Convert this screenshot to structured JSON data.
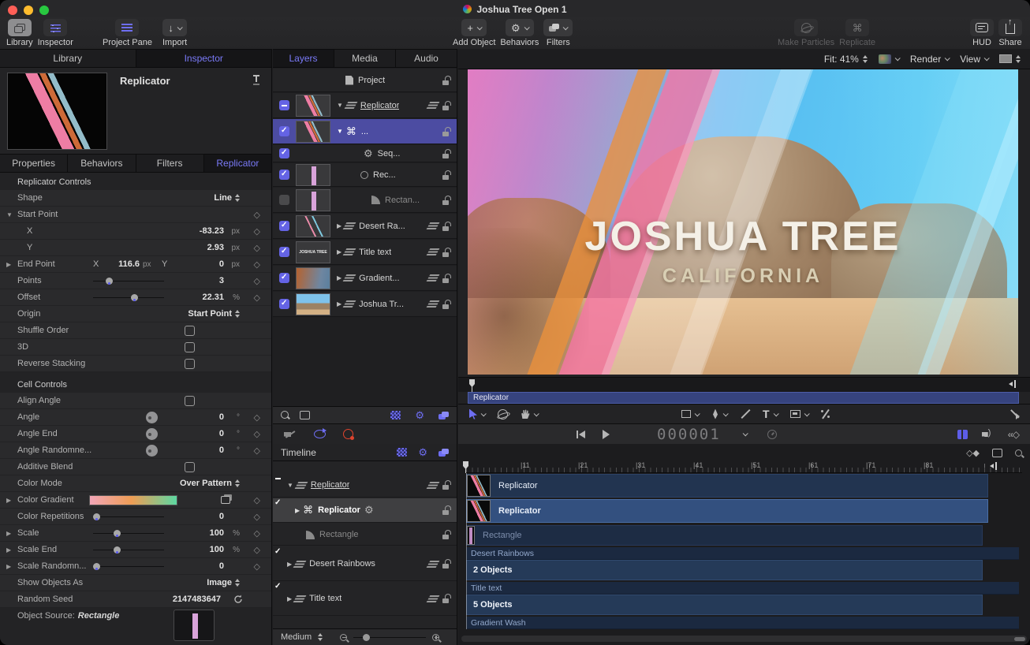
{
  "window": {
    "title": "Joshua Tree Open 1"
  },
  "toolbar": {
    "library": "Library",
    "inspector": "Inspector",
    "project_pane": "Project Pane",
    "import": "Import",
    "add_object": "Add Object",
    "behaviors": "Behaviors",
    "filters": "Filters",
    "make_particles": "Make Particles",
    "replicate": "Replicate",
    "hud": "HUD",
    "share": "Share"
  },
  "left_panel": {
    "tabs": {
      "library": "Library",
      "inspector": "Inspector"
    },
    "preview_title": "Replicator",
    "inspector_tabs": {
      "properties": "Properties",
      "behaviors": "Behaviors",
      "filters": "Filters",
      "replicator": "Replicator"
    },
    "sections": {
      "replicator_controls": "Replicator Controls",
      "cell_controls": "Cell Controls"
    },
    "rows": {
      "shape": {
        "label": "Shape",
        "value": "Line"
      },
      "start_point": {
        "label": "Start Point"
      },
      "x": {
        "label": "X",
        "value": "-83.23",
        "unit": "px"
      },
      "y": {
        "label": "Y",
        "value": "2.93",
        "unit": "px"
      },
      "end_point": {
        "label": "End Point",
        "x_label": "X",
        "x_value": "116.6",
        "x_unit": "px",
        "y_label": "Y",
        "y_value": "0",
        "y_unit": "px"
      },
      "points": {
        "label": "Points",
        "value": "3"
      },
      "offset": {
        "label": "Offset",
        "value": "22.31",
        "unit": "%"
      },
      "origin": {
        "label": "Origin",
        "value": "Start Point"
      },
      "shuffle_order": {
        "label": "Shuffle Order"
      },
      "three_d": {
        "label": "3D"
      },
      "reverse_stacking": {
        "label": "Reverse Stacking"
      },
      "align_angle": {
        "label": "Align Angle"
      },
      "angle": {
        "label": "Angle",
        "value": "0",
        "unit": "°"
      },
      "angle_end": {
        "label": "Angle End",
        "value": "0",
        "unit": "°"
      },
      "angle_randomness": {
        "label": "Angle Randomne...",
        "value": "0",
        "unit": "°"
      },
      "additive_blend": {
        "label": "Additive Blend"
      },
      "color_mode": {
        "label": "Color Mode",
        "value": "Over Pattern"
      },
      "color_gradient": {
        "label": "Color Gradient"
      },
      "color_repetitions": {
        "label": "Color Repetitions",
        "value": "0"
      },
      "scale": {
        "label": "Scale",
        "value": "100",
        "unit": "%"
      },
      "scale_end": {
        "label": "Scale End",
        "value": "100",
        "unit": "%"
      },
      "scale_randomness": {
        "label": "Scale Randomn...",
        "value": "0"
      },
      "show_objects_as": {
        "label": "Show Objects As",
        "value": "Image"
      },
      "random_seed": {
        "label": "Random Seed",
        "value": "2147483647"
      },
      "object_source": {
        "label": "Object Source:",
        "value": "Rectangle"
      }
    }
  },
  "layers_panel": {
    "tabs": {
      "layers": "Layers",
      "media": "Media",
      "audio": "Audio"
    },
    "rows": {
      "project": "Project",
      "replicator_group": "Replicator",
      "replicator_sel": "...",
      "sequence": "Seq...",
      "rec": "Rec...",
      "rectangle": "Rectan...",
      "desert": "Desert Ra...",
      "title_text": "Title text",
      "gradient": "Gradient...",
      "joshua": "Joshua Tr..."
    }
  },
  "canvas": {
    "fit_label": "Fit: 41%",
    "render_label": "Render",
    "view_label": "View",
    "title": "JOSHUA TREE",
    "subtitle": "CALIFORNIA",
    "selection_bar_label": "Replicator",
    "timecode": "000001"
  },
  "timeline": {
    "panel_title": "Timeline",
    "zoom_level": "Medium",
    "layer_list": {
      "replicator_group": "Replicator",
      "replicator": "Replicator",
      "rectangle": "Rectangle",
      "desert": "Desert Rainbows",
      "title_text": "Title text"
    },
    "ruler_ticks": [
      "|11",
      "|21",
      "|31",
      "|41",
      "|51",
      "|61",
      "|71",
      "|81"
    ],
    "tracks": {
      "replicator_group": "Replicator",
      "replicator": "Replicator",
      "rectangle": "Rectangle",
      "desert_header": "Desert Rainbows",
      "desert_objects": "2 Objects",
      "title_header": "Title text",
      "title_objects": "5 Objects",
      "gradient_header": "Gradient Wash"
    }
  },
  "colors": {
    "accent_blue": "#6e6ef2",
    "selection_indigo": "#4c4ca2",
    "track_blue": "#253a58",
    "record_red": "#e0442e"
  }
}
